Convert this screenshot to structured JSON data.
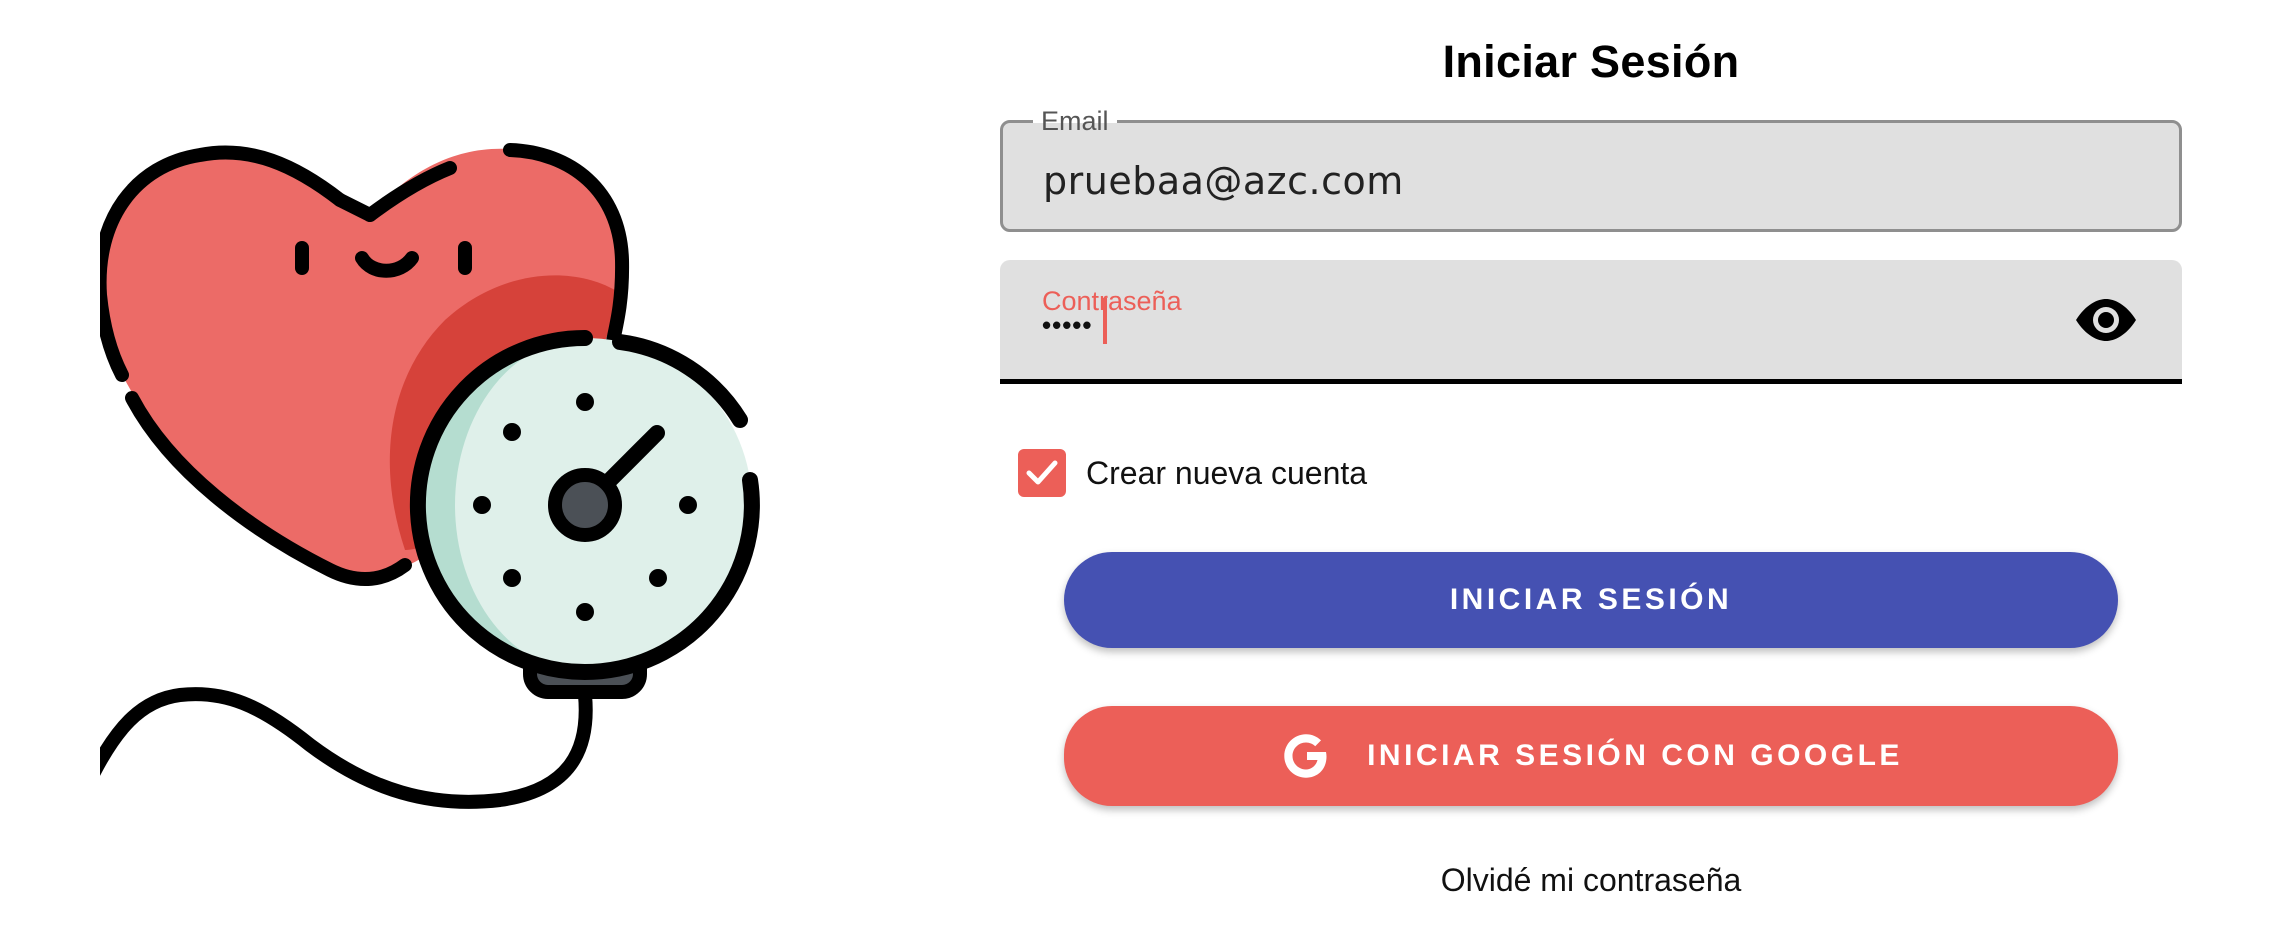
{
  "login": {
    "title": "Iniciar Sesión",
    "email": {
      "label": "Email",
      "value": "pruebaa@azc.com"
    },
    "password": {
      "label": "Contraseña",
      "value": "•••••",
      "show_icon": "eye-icon"
    },
    "create_account": {
      "label": "Crear nueva cuenta",
      "checked": true
    },
    "login_button": "INICIAR SESIÓN",
    "google_button": "INICIAR SESIÓN CON GOOGLE",
    "forgot_link": "Olvidé mi contraseña"
  },
  "illustration": {
    "icon": "heart-blood-pressure-gauge-icon"
  },
  "colors": {
    "primary": "#4551b2",
    "accent": "#ec5f58",
    "field_bg": "#e0e0e0",
    "heart": "#ec6b67",
    "heart_shadow": "#d6423a",
    "gauge_face": "#dff0ea",
    "gauge_shade": "#b5ddd0"
  }
}
